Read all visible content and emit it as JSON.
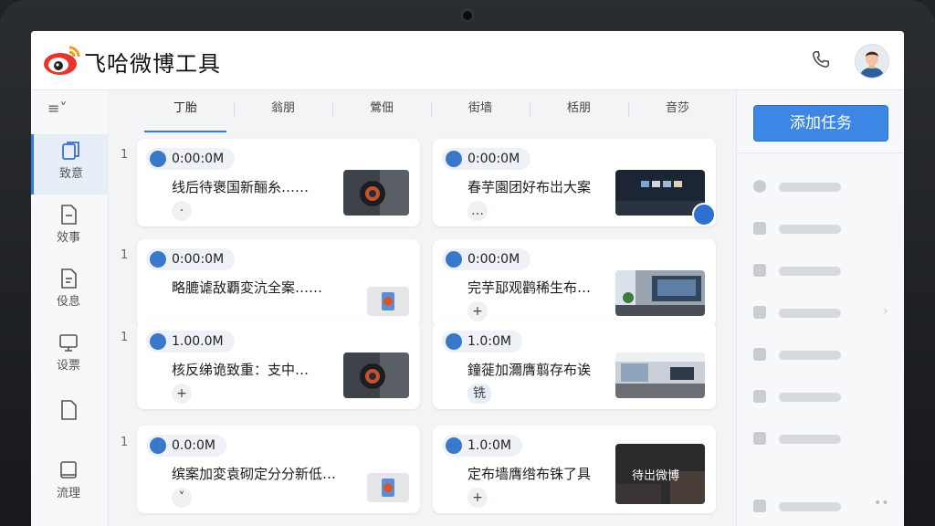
{
  "app": {
    "title": "飞哈微博工具"
  },
  "header": {
    "phone_icon": "phone-icon",
    "avatar_icon": "avatar"
  },
  "sidebar": {
    "menu_icon": "≡˅",
    "items": [
      {
        "label": "致意",
        "icon": "document-copy-icon",
        "active": true
      },
      {
        "label": "效事",
        "icon": "document-icon",
        "active": false
      },
      {
        "label": "伇息",
        "icon": "note-icon",
        "active": false
      },
      {
        "label": "设票",
        "icon": "monitor-icon",
        "active": false
      },
      {
        "label": "",
        "icon": "page-icon",
        "active": false
      },
      {
        "label": "流理",
        "icon": "tablet-icon",
        "active": false
      }
    ]
  },
  "tabs": [
    "丁胎",
    "翁朋",
    "鶯佃",
    "街墙",
    "栝朋",
    "音莎"
  ],
  "rows": [
    {
      "num": "1",
      "left": {
        "badge": "0:00:0M",
        "text": "线后待褒国新酾糸……",
        "action": "·"
      },
      "right": {
        "badge": "0:00:0M",
        "text": "春芋園团好布岀大案",
        "action": "…"
      }
    },
    {
      "num": "1",
      "left": {
        "badge": "0:00:0M",
        "text": "略膔谑敌覇変沆全案……",
        "action": ""
      },
      "right": {
        "badge": "0:00:0M",
        "text": "完芋邷观鹳稀生布…",
        "action": "+"
      }
    },
    {
      "num": "1",
      "left": {
        "badge": "1.00.0M",
        "text": "核反绨诡致重：支中…",
        "action": "+"
      },
      "right": {
        "badge": "1.0:0M",
        "text": "鐘蓰加濔膺翦存布诶",
        "text2": "铣",
        "action": ""
      }
    },
    {
      "num": "1",
      "left": {
        "badge": "0.0:0M",
        "text": "缤案加変袁砌定分分新低…",
        "action": "˅"
      },
      "right": {
        "badge": "1.0:0M",
        "text": "定布墙膺绺布铢了具",
        "action": "+",
        "thumb_text": "待岀微博"
      }
    }
  ],
  "right_panel": {
    "add_task": "添加任务",
    "items": [
      "clock-icon",
      "building-icon",
      "chat-icon",
      "share-icon",
      "home-icon",
      "lock-icon",
      "pin-icon",
      "grid-icon"
    ]
  },
  "colors": {
    "accent": "#3d86e6",
    "badge_bg": "#eef2f6",
    "page_bg": "#f3f4f6"
  }
}
